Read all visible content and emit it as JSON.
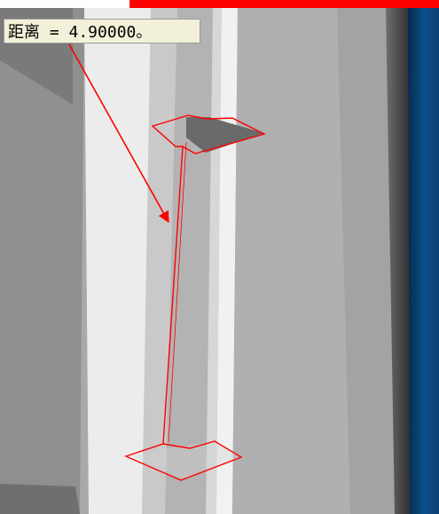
{
  "measurement": {
    "label": "距离 = 4.90000。"
  },
  "colors": {
    "accent_red": "#ff0000",
    "label_bg": "#f2f0d8",
    "blue_panel": "#0b4f8c"
  }
}
